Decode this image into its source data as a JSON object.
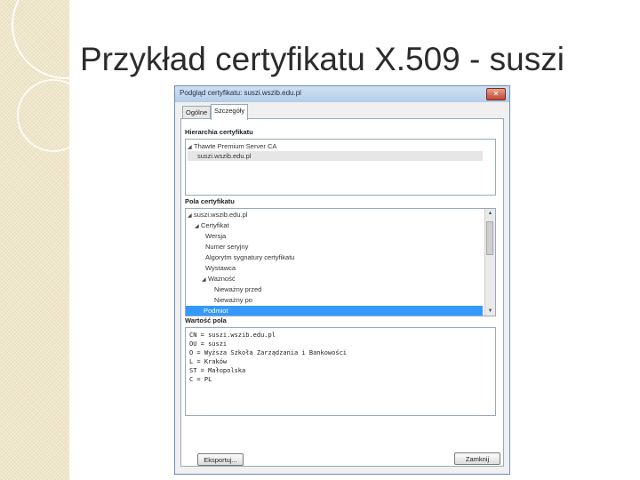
{
  "slide": {
    "title": "Przykład certyfikatu X.509 - suszi"
  },
  "dialog": {
    "title": "Podgląd certyfikatu: suszi.wszib.edu.pl",
    "close_icon": "close-icon",
    "tabs": [
      {
        "label": "Ogólne"
      },
      {
        "label": "Szczegóły"
      }
    ],
    "hierarchy": {
      "label": "Hierarchia certyfikatu",
      "items": [
        {
          "label": "Thawte Premium Server CA"
        },
        {
          "label": "suszi.wszib.edu.pl"
        }
      ]
    },
    "fields": {
      "label": "Pola certyfikatu",
      "items": [
        {
          "label": "suszi.wszib.edu.pl"
        },
        {
          "label": "Certyfikat"
        },
        {
          "label": "Wersja"
        },
        {
          "label": "Numer seryjny"
        },
        {
          "label": "Algorytm sygnatury certyfikatu"
        },
        {
          "label": "Wystawca"
        },
        {
          "label": "Ważność"
        },
        {
          "label": "Nieważny przed"
        },
        {
          "label": "Nieważny po"
        },
        {
          "label": "Podmiot"
        }
      ]
    },
    "value": {
      "label": "Wartość pola",
      "lines": [
        "CN = suszi.wszib.edu.pl",
        "OU = suszi",
        "O = Wyższa Szkoła Zarządzania i Bankowości",
        "L = Kraków",
        "ST = Małopolska",
        "C = PL"
      ]
    },
    "export_button": "Eksportuj...",
    "close_button": "Zamknij"
  }
}
